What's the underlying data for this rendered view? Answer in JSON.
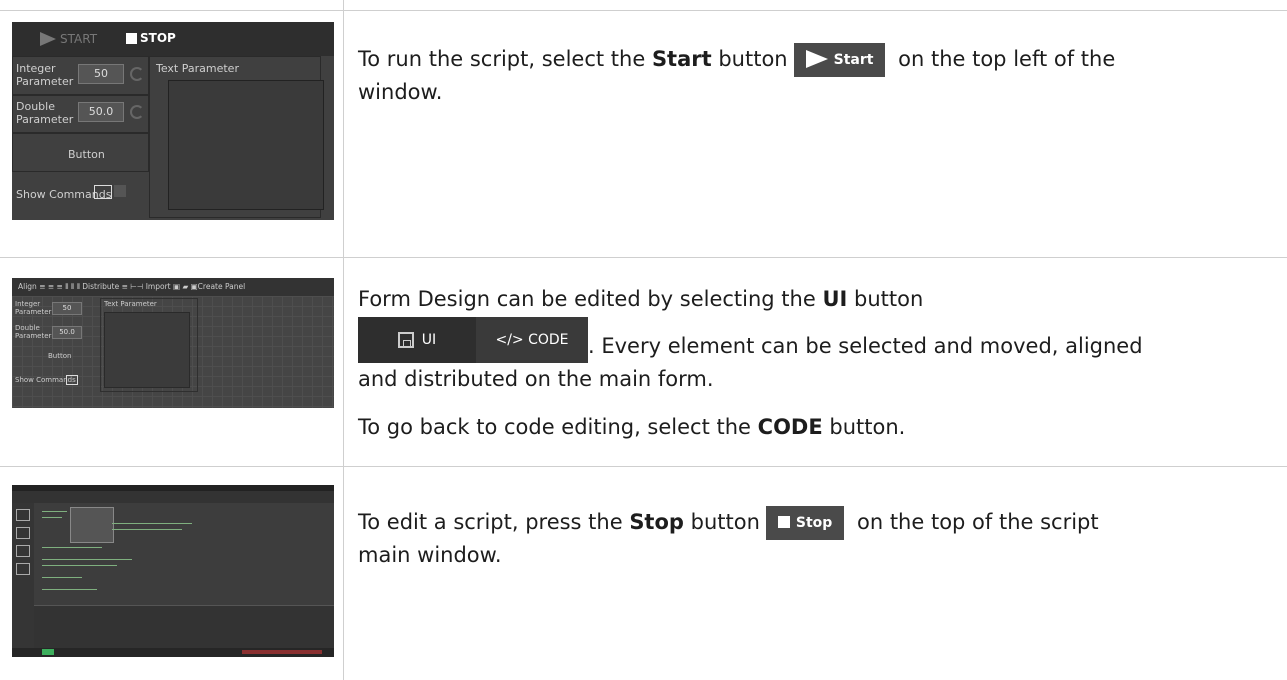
{
  "rows": [
    {
      "thumbnail": {
        "start_label": "START",
        "stop_label": "STOP",
        "integer_label_1": "Integer",
        "integer_label_2": "Parameter",
        "integer_value": "50",
        "double_label_1": "Double",
        "double_label_2": "Parameter",
        "double_value": "50.0",
        "button_label": "Button",
        "show_commands": "Show Commands",
        "text_parameter": "Text Parameter"
      },
      "text_before": "To run the script, select the ",
      "bold": "Start",
      "text_mid": " button",
      "inline_button": "Start",
      "text_after_1": " on the top left of the",
      "text_after_2": "window."
    },
    {
      "thumbnail": {
        "toolbar": "Align   ≡  ≡  ≡  ⦀  ⦀  ⦀   Distribute  ≡  ⊢⊣   Import  ▣  ▰  ▣Create Panel",
        "integer_label_1": "Integer",
        "integer_label_2": "Parameter",
        "integer_value": "50",
        "double_label_1": "Double",
        "double_label_2": "Parameter",
        "double_value": "50.0",
        "button_label": "Button",
        "show_commands": "Show Commands",
        "text_parameter": "Text Parameter"
      },
      "line1_before": "Form Design can be edited by selecting the ",
      "line1_bold": "UI",
      "line1_after": " button",
      "ui_label": "UI",
      "code_label": "</> CODE",
      "line2": ". Every element can be selected and moved, aligned",
      "line3": "and distributed on the main form.",
      "line4_before": "To go back to code editing, select the ",
      "line4_bold": "CODE",
      "line4_after": " button."
    },
    {
      "text_before": "To edit a script, press the ",
      "bold": "Stop",
      "text_mid": " button",
      "inline_button": "Stop",
      "text_after_1": " on the top of the script",
      "text_after_2": "main window."
    }
  ]
}
